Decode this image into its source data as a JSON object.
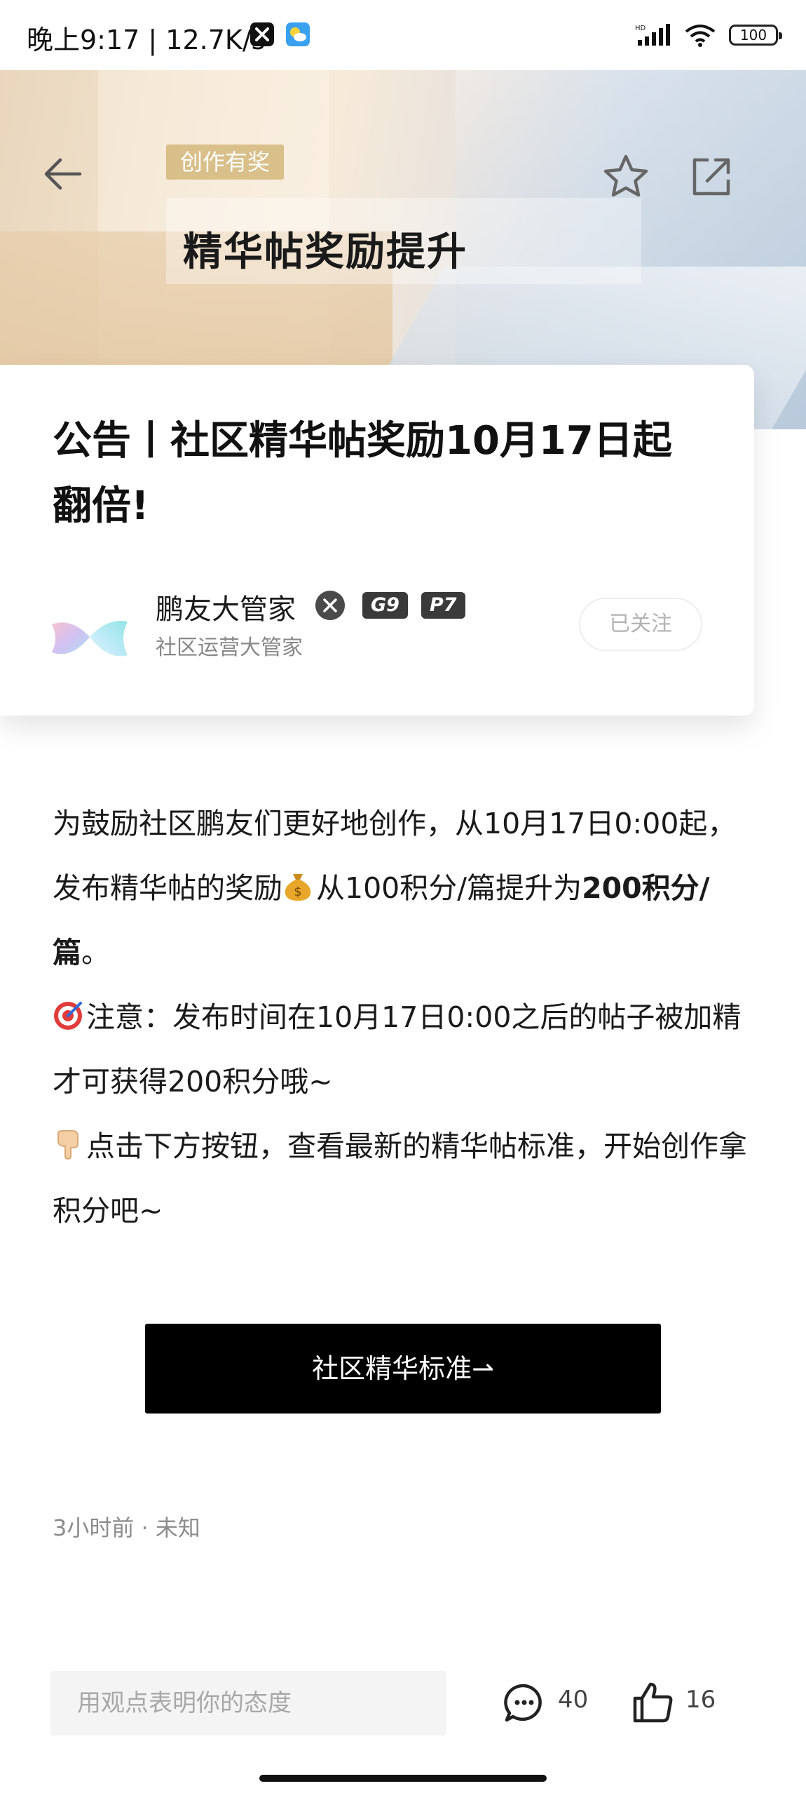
{
  "status_bar": {
    "time_speed": "晚上9:17 | 12.7K/s",
    "network": "HD",
    "battery": "100"
  },
  "hero": {
    "tag": "创作有奖",
    "title": "精华帖奖励提升"
  },
  "post": {
    "title": "公告丨社区精华帖奖励10月17日起翻倍!",
    "author": {
      "name": "鹏友大管家",
      "badges": [
        "G9",
        "P7"
      ],
      "role": "社区运营大管家",
      "follow_label": "已关注"
    },
    "body": {
      "p1_text": "为鼓励社区鹏友们更好地创作，从10月17日0:00起，发布精华帖的奖励",
      "p1_mid": "从100积分/篇提升为",
      "p1_bold": "200积分/篇",
      "p1_end": "。",
      "p2": "注意：发布时间在10月17日0:00之后的帖子被加精才可获得200积分哦~",
      "p3": "点击下方按钮，查看最新的精华帖标准，开始创作拿积分吧~"
    },
    "cta_label": "社区精华标准⇀",
    "meta": "3小时前 · 未知"
  },
  "bottom_bar": {
    "input_placeholder": "用观点表明你的态度",
    "comment_count": "40",
    "like_count": "16"
  },
  "icons": {
    "back": "back-arrow-icon",
    "favorite": "star-icon",
    "share": "share-icon",
    "comment": "comment-icon",
    "like": "thumbs-up-icon"
  },
  "colors": {
    "tag_bg": "#d2b478",
    "cta_bg": "#000000"
  }
}
